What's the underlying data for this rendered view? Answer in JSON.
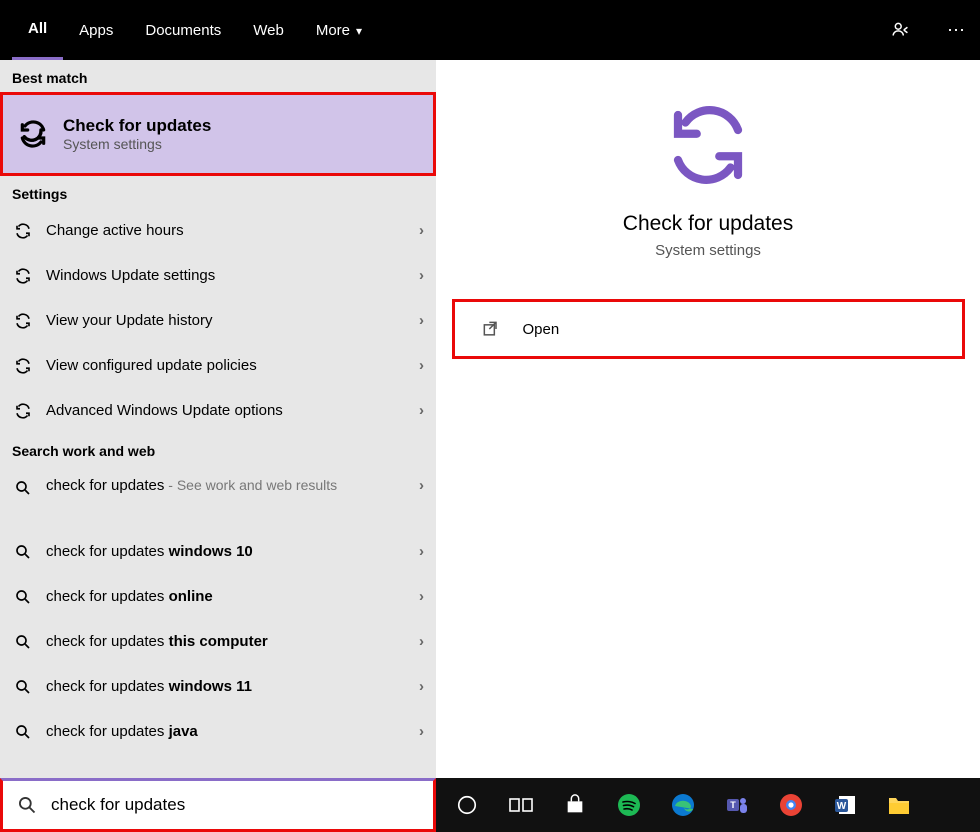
{
  "topbar": {
    "tabs": [
      "All",
      "Apps",
      "Documents",
      "Web",
      "More"
    ]
  },
  "left": {
    "best_match_hdr": "Best match",
    "best_match": {
      "title": "Check for updates",
      "subtitle": "System settings"
    },
    "settings_hdr": "Settings",
    "settings": [
      "Change active hours",
      "Windows Update settings",
      "View your Update history",
      "View configured update policies",
      "Advanced Windows Update options"
    ],
    "web_hdr": "Search work and web",
    "web_items": [
      {
        "prefix": "check for updates",
        "bold": "",
        "suffix": " - See work and web results"
      },
      {
        "prefix": "check for updates ",
        "bold": "windows 10",
        "suffix": ""
      },
      {
        "prefix": "check for updates ",
        "bold": "online",
        "suffix": ""
      },
      {
        "prefix": "check for updates ",
        "bold": "this computer",
        "suffix": ""
      },
      {
        "prefix": "check for updates ",
        "bold": "windows 11",
        "suffix": ""
      },
      {
        "prefix": "check for updates ",
        "bold": "java",
        "suffix": ""
      }
    ]
  },
  "right": {
    "title": "Check for updates",
    "subtitle": "System settings",
    "open_label": "Open"
  },
  "search": {
    "value": "check for updates"
  }
}
